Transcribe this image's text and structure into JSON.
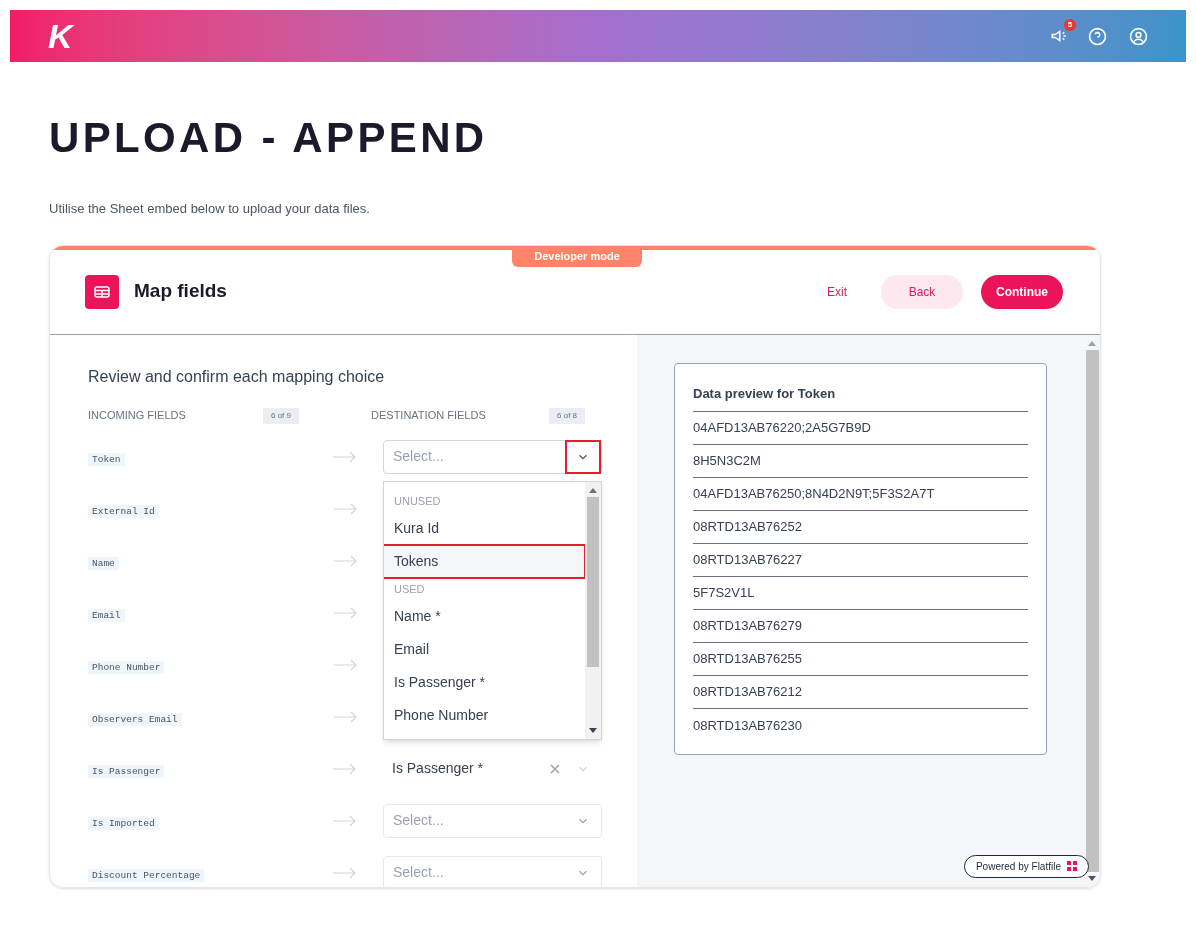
{
  "header": {
    "logo": "K",
    "notifications": "5"
  },
  "page": {
    "title": "UPLOAD - APPEND",
    "subtitle": "Utilise the Sheet embed below to upload your data files."
  },
  "embed": {
    "badge": "Developer mode",
    "title": "Map fields",
    "buttons": [
      {
        "label": "Exit",
        "kind": "text"
      },
      {
        "label": "Back",
        "kind": "secondary"
      },
      {
        "label": "Continue",
        "kind": "primary"
      }
    ],
    "mapping": {
      "heading": "Review and confirm each mapping choice",
      "incoming_header": "INCOMING FIELDS",
      "incoming_count": "6 of 9",
      "destination_header": "DESTINATION FIELDS",
      "destination_count": "6 of 8",
      "rows": [
        {
          "incoming": "Token",
          "destination": {
            "kind": "select",
            "placeholder": "Select...",
            "open": true,
            "caret_outlined": true
          }
        },
        {
          "incoming": "External Id"
        },
        {
          "incoming": "Name"
        },
        {
          "incoming": "Email"
        },
        {
          "incoming": "Phone Number"
        },
        {
          "incoming": "Observers Email"
        },
        {
          "incoming": "Is Passenger",
          "destination": {
            "kind": "value",
            "value": "Is Passenger *"
          }
        },
        {
          "incoming": "Is Imported",
          "destination": {
            "kind": "select",
            "placeholder": "Select...",
            "open": false,
            "caret_outlined": false
          }
        },
        {
          "incoming": "Discount Percentage",
          "destination": {
            "kind": "select",
            "placeholder": "Select...",
            "open": false,
            "caret_outlined": false
          }
        }
      ],
      "dropdown": {
        "groups": [
          {
            "label": "UNUSED",
            "options": [
              {
                "label": "Kura Id",
                "highlighted": false
              },
              {
                "label": "Tokens",
                "highlighted": true
              }
            ]
          },
          {
            "label": "USED",
            "options": [
              {
                "label": "Name *",
                "highlighted": false
              },
              {
                "label": "Email",
                "highlighted": false
              },
              {
                "label": "Is Passenger *",
                "highlighted": false
              },
              {
                "label": "Phone Number",
                "highlighted": false
              }
            ]
          }
        ]
      }
    },
    "preview": {
      "title": "Data preview for Token",
      "values": [
        "04AFD13AB76220;2A5G7B9D",
        "8H5N3C2M",
        "04AFD13AB76250;8N4D2N9T;5F3S2A7T",
        "08RTD13AB76252",
        "08RTD13AB76227",
        "5F7S2V1L",
        "08RTD13AB76279",
        "08RTD13AB76255",
        "08RTD13AB76212",
        "08RTD13AB76230"
      ]
    },
    "powered_by": "Powered by Flatfile"
  }
}
